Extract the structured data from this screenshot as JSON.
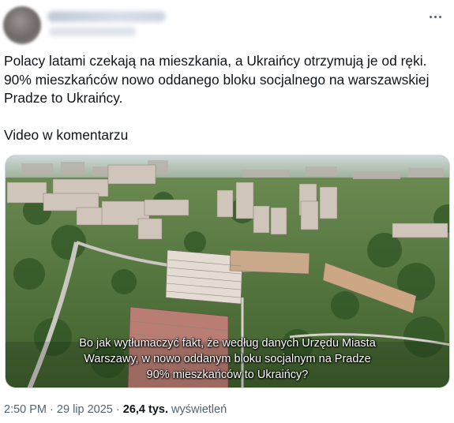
{
  "post": {
    "text_lines": [
      "Polacy latami czekają na mieszkania, a Ukraińcy otrzymują je od ręki.",
      "90% mieszkańców nowo oddanego bloku socjalnego na warszawskiej",
      "Pradze to Ukraińcy."
    ],
    "text_footer": "Video w komentarzu",
    "media": {
      "subtitle_lines": [
        "Bo jak wytłumaczyć fakt, że według danych Urzędu Miasta",
        "Warszawy, w nowo oddanym bloku socjalnym na Pradze",
        "90% mieszkańców to Ukraińcy?"
      ]
    },
    "meta": {
      "time": "2:50 PM",
      "separator": "·",
      "date": "29 lip 2025",
      "views_count": "26,4 tys.",
      "views_label": "wyświetleń"
    }
  },
  "icons": {
    "more": "more-horizontal-icon"
  }
}
